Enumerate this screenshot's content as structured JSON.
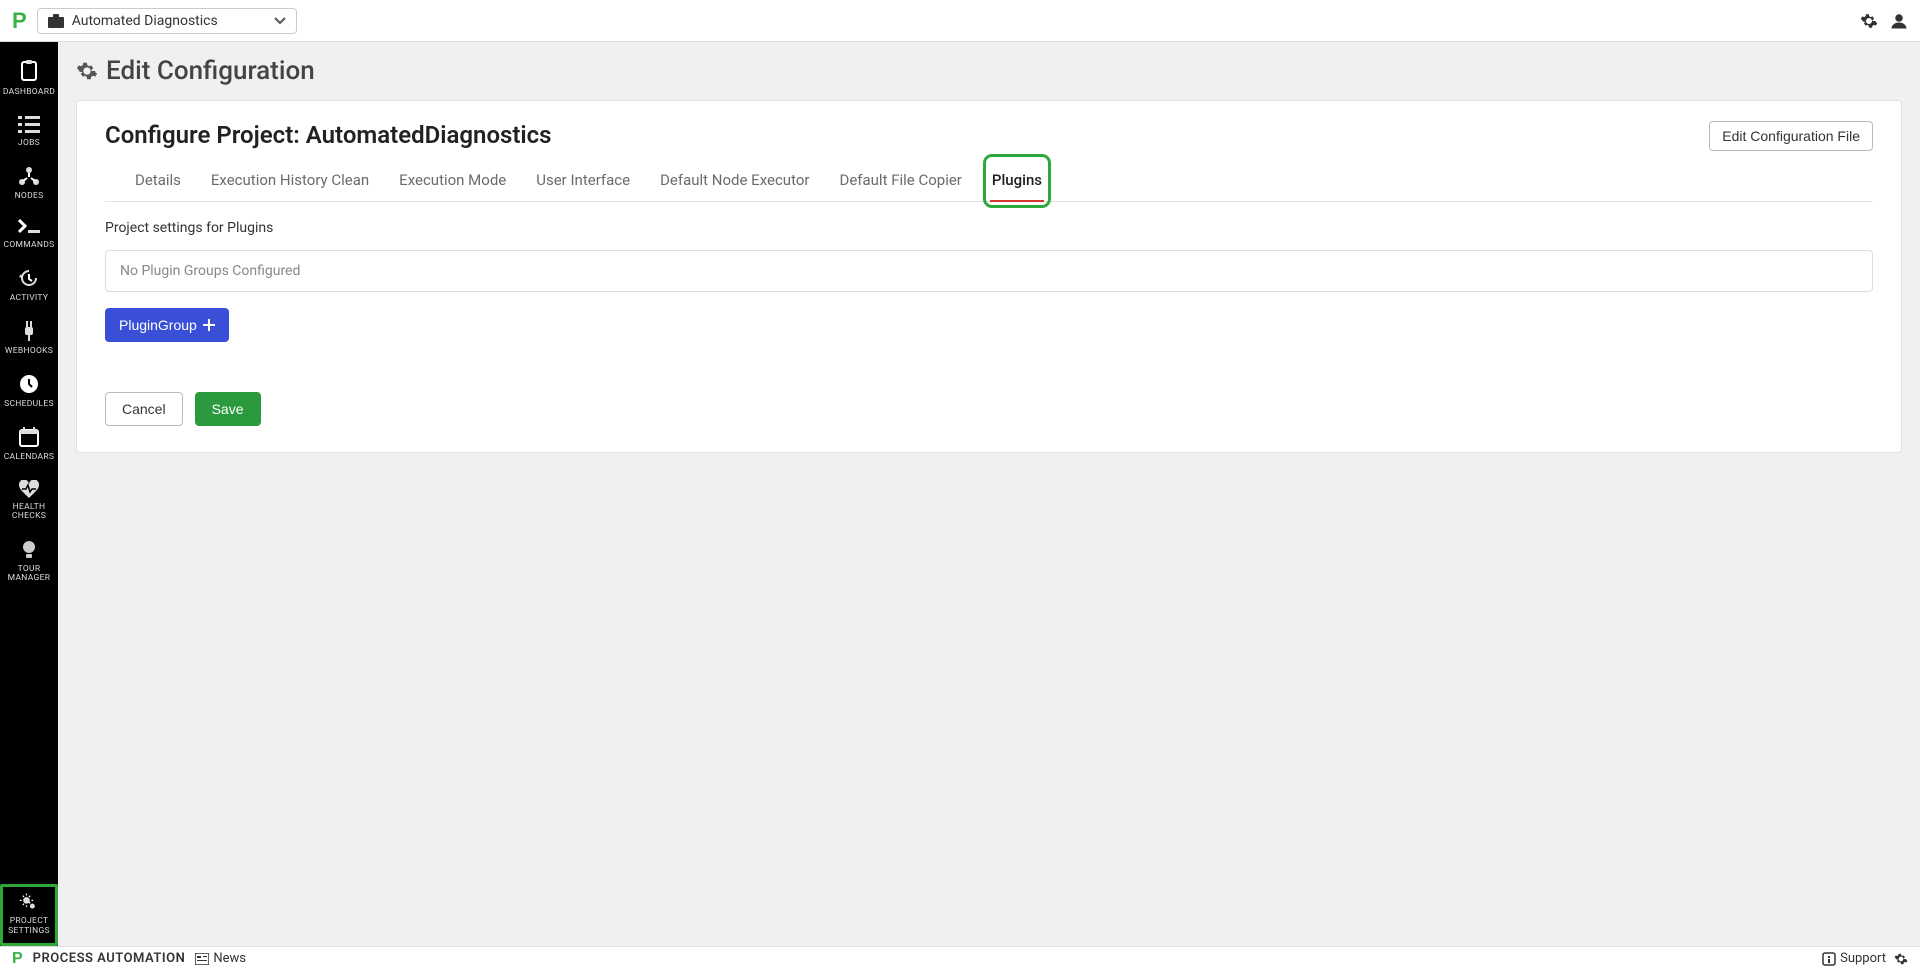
{
  "topbar": {
    "project_selector_label": "Automated Diagnostics"
  },
  "sidebar": {
    "items": [
      {
        "label": "DASHBOARD",
        "icon": "clipboard"
      },
      {
        "label": "JOBS",
        "icon": "list"
      },
      {
        "label": "NODES",
        "icon": "nodes"
      },
      {
        "label": "COMMANDS",
        "icon": "terminal"
      },
      {
        "label": "ACTIVITY",
        "icon": "history"
      },
      {
        "label": "WEBHOOKS",
        "icon": "plug"
      },
      {
        "label": "SCHEDULES",
        "icon": "clock"
      },
      {
        "label": "CALENDARS",
        "icon": "calendar"
      },
      {
        "label": "HEALTH CHECKS",
        "icon": "heartbeat"
      },
      {
        "label": "TOUR MANAGER",
        "icon": "bulb"
      }
    ],
    "bottom_item": {
      "label": "PROJECT SETTINGS",
      "icon": "cogs"
    }
  },
  "page": {
    "title": "Edit Configuration",
    "configure_label": "Configure Project:",
    "project_name": "AutomatedDiagnostics",
    "edit_config_file_btn": "Edit Configuration File"
  },
  "tabs": [
    "Details",
    "Execution History Clean",
    "Execution Mode",
    "User Interface",
    "Default Node Executor",
    "Default File Copier",
    "Plugins"
  ],
  "active_tab_index": 6,
  "content": {
    "section_text": "Project settings for Plugins",
    "empty_message": "No Plugin Groups Configured",
    "add_plugin_btn": "PluginGroup"
  },
  "buttons": {
    "cancel": "Cancel",
    "save": "Save"
  },
  "statusbar": {
    "brand": "PROCESS AUTOMATION",
    "news": "News",
    "support": "Support"
  }
}
